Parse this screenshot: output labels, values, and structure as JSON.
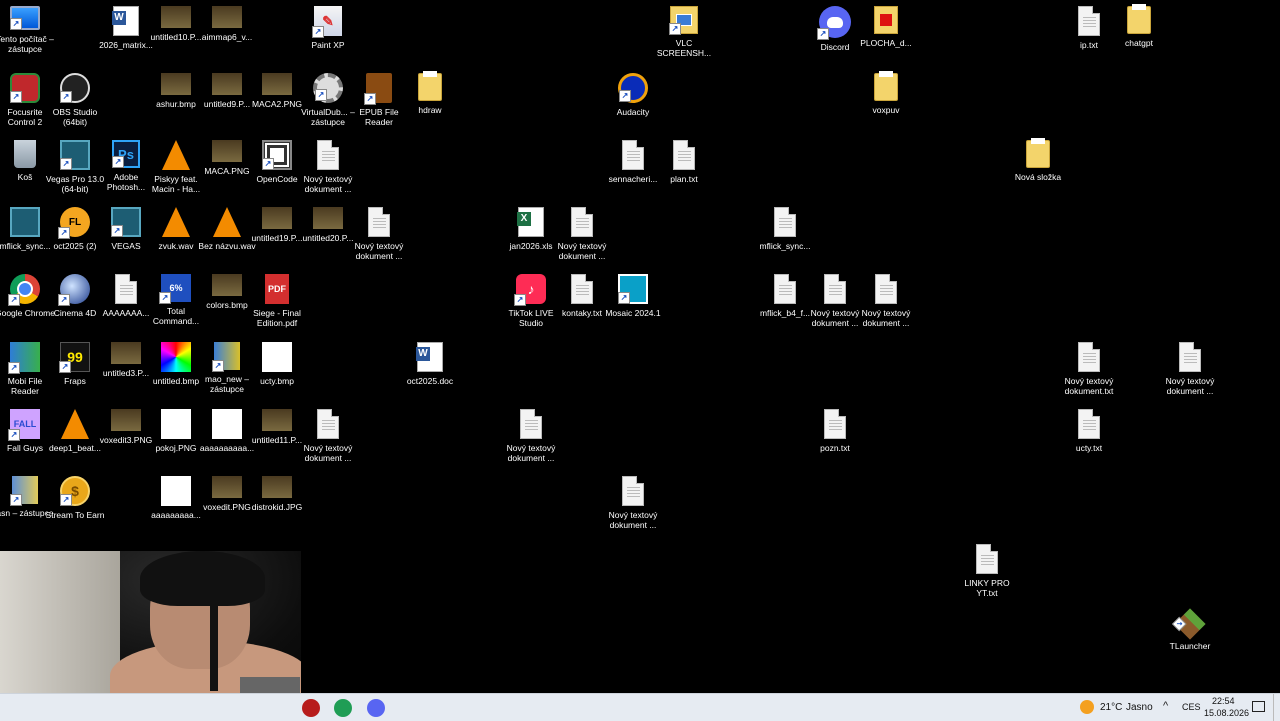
{
  "desktop": {
    "icons": [
      {
        "label": "Tento počítač – zástupce",
        "glyph": "monitor",
        "icon": "computer-icon",
        "shortcut": true
      },
      {
        "label": "Focusrite Control 2",
        "glyph": "focus",
        "icon": "focusrite-icon",
        "shortcut": true
      },
      {
        "label": "Koš",
        "glyph": "bin",
        "icon": "recycle-bin-icon",
        "shortcut": false
      },
      {
        "label": "mflick_sync...",
        "glyph": "vegas",
        "icon": "video-file-icon",
        "shortcut": false
      },
      {
        "label": "Google Chrome",
        "glyph": "chrome",
        "icon": "chrome-icon",
        "shortcut": true
      },
      {
        "label": "Mobi File Reader",
        "glyph": "mobi",
        "icon": "mobi-reader-icon",
        "shortcut": true
      },
      {
        "label": "Fall Guys",
        "glyph": "fall",
        "icon": "fall-guys-icon",
        "glyph_text": "FALL",
        "shortcut": true
      },
      {
        "label": "asn – zástupce",
        "glyph": "inst",
        "icon": "archive-icon",
        "shortcut": true
      },
      {
        "label": "OBS Studio (64bit)",
        "glyph": "obs",
        "icon": "obs-icon",
        "shortcut": true
      },
      {
        "label": "Vegas Pro 13.0 (64-bit)",
        "glyph": "vegas",
        "icon": "vegas-icon",
        "shortcut": true
      },
      {
        "label": "oct2025 (2)",
        "glyph": "fl",
        "icon": "fl-studio-icon",
        "glyph_text": "FL",
        "shortcut": true
      },
      {
        "label": "Cinema 4D",
        "glyph": "c4d",
        "icon": "cinema4d-icon",
        "shortcut": true
      },
      {
        "label": "Fraps",
        "glyph": "fraps",
        "icon": "fraps-icon",
        "glyph_text": "99",
        "shortcut": true
      },
      {
        "label": "deep1_beat...",
        "glyph": "vlc",
        "icon": "vlc-file-icon",
        "shortcut": false
      },
      {
        "label": "Stream To Earn",
        "glyph": "coin",
        "icon": "coin-icon",
        "glyph_text": "$",
        "shortcut": true
      },
      {
        "label": "2026_matrix...",
        "glyph": "word",
        "icon": "word-doc-icon",
        "shortcut": false
      },
      {
        "label": "Adobe Photosh...",
        "glyph": "ps",
        "icon": "photoshop-icon",
        "glyph_text": "Ps",
        "shortcut": true
      },
      {
        "label": "VEGAS",
        "glyph": "vegas",
        "icon": "vegas-icon",
        "shortcut": true
      },
      {
        "label": "AAAAAAA...",
        "glyph": "doc",
        "icon": "text-file-icon",
        "shortcut": false
      },
      {
        "label": "untitled3.P...",
        "glyph": "img",
        "icon": "image-file-icon",
        "shortcut": false
      },
      {
        "label": "voxedit3.PNG",
        "glyph": "img",
        "icon": "image-file-icon",
        "shortcut": false
      },
      {
        "label": "untitled10.P...",
        "glyph": "img",
        "icon": "image-file-icon",
        "shortcut": false
      },
      {
        "label": "ashur.bmp",
        "glyph": "img",
        "icon": "image-file-icon",
        "shortcut": false
      },
      {
        "label": "Piskyy feat. Macin - Ha...",
        "glyph": "vlc",
        "icon": "vlc-file-icon",
        "shortcut": false
      },
      {
        "label": "zvuk.wav",
        "glyph": "vlc",
        "icon": "vlc-file-icon",
        "shortcut": false
      },
      {
        "label": "Total Command...",
        "glyph": "total",
        "icon": "total-commander-icon",
        "glyph_text": "6%",
        "shortcut": true
      },
      {
        "label": "untitled.bmp",
        "glyph": "imgcolor",
        "icon": "image-file-icon",
        "shortcut": false
      },
      {
        "label": "pokoj.PNG",
        "glyph": "imgw",
        "icon": "image-file-icon",
        "shortcut": false
      },
      {
        "label": "aaaaaaaaa...",
        "glyph": "imgw",
        "icon": "image-file-icon",
        "shortcut": false
      },
      {
        "label": "aimmap6_v...",
        "glyph": "img",
        "icon": "image-file-icon",
        "shortcut": false
      },
      {
        "label": "untitled9.P...",
        "glyph": "img",
        "icon": "image-file-icon",
        "shortcut": false
      },
      {
        "label": "MACA.PNG",
        "glyph": "img",
        "icon": "image-file-icon",
        "shortcut": false
      },
      {
        "label": "Bez názvu.wav",
        "glyph": "vlc",
        "icon": "vlc-file-icon",
        "shortcut": false
      },
      {
        "label": "colors.bmp",
        "glyph": "img",
        "icon": "image-file-icon",
        "shortcut": false
      },
      {
        "label": "mao_new – zástupce",
        "glyph": "winrar",
        "icon": "archive-icon",
        "shortcut": true
      },
      {
        "label": "aaaaaaaaaa...",
        "glyph": "imgw",
        "icon": "image-file-icon",
        "shortcut": false
      },
      {
        "label": "voxedit.PNG",
        "glyph": "img",
        "icon": "image-file-icon",
        "shortcut": false
      },
      {
        "label": "MACA2.PNG",
        "glyph": "img",
        "icon": "image-file-icon",
        "shortcut": false
      },
      {
        "label": "OpenCode",
        "glyph": "opencode",
        "icon": "opencode-icon",
        "shortcut": true
      },
      {
        "label": "untitled19.P...",
        "glyph": "img",
        "icon": "image-file-icon",
        "shortcut": false
      },
      {
        "label": "Siege - Final Edition.pdf",
        "glyph": "pdf",
        "icon": "pdf-icon",
        "glyph_text": "PDF",
        "shortcut": false
      },
      {
        "label": "ucty.bmp",
        "glyph": "imgw",
        "icon": "image-file-icon",
        "shortcut": false
      },
      {
        "label": "untitled11.P...",
        "glyph": "img",
        "icon": "image-file-icon",
        "shortcut": false
      },
      {
        "label": "distrokid.JPG",
        "glyph": "img",
        "icon": "image-file-icon",
        "shortcut": false
      },
      {
        "label": "Paint XP",
        "glyph": "paint",
        "icon": "paint-icon",
        "glyph_text": "✎",
        "shortcut": true
      },
      {
        "label": "VirtualDub... – zástupce",
        "glyph": "gear",
        "icon": "virtualdub-icon",
        "shortcut": true
      },
      {
        "label": "Nový textový dokument ...",
        "glyph": "doc",
        "icon": "text-file-icon",
        "shortcut": false
      },
      {
        "label": "untitled20.P...",
        "glyph": "img",
        "icon": "image-file-icon",
        "shortcut": false
      },
      {
        "label": "Nový textový dokument ...",
        "glyph": "doc",
        "icon": "text-file-icon",
        "shortcut": false
      },
      {
        "label": "EPUB File Reader",
        "glyph": "epub",
        "icon": "epub-reader-icon",
        "shortcut": true
      },
      {
        "label": "Nový textový dokument ...",
        "glyph": "doc",
        "icon": "text-file-icon",
        "shortcut": false
      },
      {
        "label": "hdraw",
        "glyph": "folder",
        "icon": "folder-icon",
        "shortcut": false
      },
      {
        "label": "oct2025.doc",
        "glyph": "word",
        "icon": "word-doc-icon",
        "shortcut": false
      },
      {
        "label": "jan2026.xls",
        "glyph": "excel",
        "icon": "excel-file-icon",
        "shortcut": false
      },
      {
        "label": "TikTok LIVE Studio",
        "glyph": "tiktok",
        "icon": "tiktok-icon",
        "glyph_text": "♪",
        "shortcut": true
      },
      {
        "label": "Nový textový dokument ...",
        "glyph": "doc",
        "icon": "text-file-icon",
        "shortcut": false
      },
      {
        "label": "Nový textový dokument ...",
        "glyph": "doc",
        "icon": "text-file-icon",
        "shortcut": false
      },
      {
        "label": "kontaky.txt",
        "glyph": "doc",
        "icon": "text-file-icon",
        "shortcut": false
      },
      {
        "label": "Audacity",
        "glyph": "audacity",
        "icon": "audacity-icon",
        "shortcut": true
      },
      {
        "label": "sennacheri...",
        "glyph": "doc",
        "icon": "text-file-icon",
        "shortcut": false
      },
      {
        "label": "Mosaic 2024.1",
        "glyph": "mosaic",
        "icon": "mosaic-icon",
        "shortcut": true
      },
      {
        "label": "Nový textový dokument ...",
        "glyph": "doc",
        "icon": "text-file-icon",
        "shortcut": false
      },
      {
        "label": "VLC SCREENSH...",
        "glyph": "vlcfolder",
        "icon": "folder-icon",
        "shortcut": true
      },
      {
        "label": "plan.txt",
        "glyph": "doc",
        "icon": "text-file-icon",
        "shortcut": false
      },
      {
        "label": "mflick_sync...",
        "glyph": "doc",
        "icon": "text-file-icon",
        "shortcut": false
      },
      {
        "label": "mflick_b4_f...",
        "glyph": "doc",
        "icon": "text-file-icon",
        "shortcut": false
      },
      {
        "label": "Discord",
        "glyph": "discord",
        "icon": "discord-icon",
        "shortcut": true
      },
      {
        "label": "Nový textový dokument ...",
        "glyph": "doc",
        "icon": "text-file-icon",
        "shortcut": false
      },
      {
        "label": "pozn.txt",
        "glyph": "doc",
        "icon": "text-file-icon",
        "shortcut": false
      },
      {
        "label": "PLOCHA_d...",
        "glyph": "pfolder",
        "icon": "folder-icon",
        "shortcut": false
      },
      {
        "label": "voxpuv",
        "glyph": "folder",
        "icon": "folder-icon",
        "shortcut": false
      },
      {
        "label": "Nový textový dokument ...",
        "glyph": "doc",
        "icon": "text-file-icon",
        "shortcut": false
      },
      {
        "label": "LINKY PRO YT.txt",
        "glyph": "doc",
        "icon": "text-file-icon",
        "shortcut": false
      },
      {
        "label": "Nová složka",
        "glyph": "folder",
        "icon": "folder-icon",
        "shortcut": false
      },
      {
        "label": "ucty.txt",
        "glyph": "doc",
        "icon": "text-file-icon",
        "shortcut": false
      },
      {
        "label": "ip.txt",
        "glyph": "doc",
        "icon": "text-file-icon",
        "shortcut": false
      },
      {
        "label": "Nový textový dokument.txt",
        "glyph": "doc",
        "icon": "text-file-icon",
        "shortcut": false
      },
      {
        "label": "chatgpt",
        "glyph": "folder",
        "icon": "folder-icon",
        "shortcut": false
      },
      {
        "label": "Nový textový dokument ...",
        "glyph": "doc",
        "icon": "text-file-icon",
        "shortcut": false
      },
      {
        "label": "TLauncher",
        "glyph": "mc",
        "icon": "minecraft-icon",
        "shortcut": true
      }
    ]
  },
  "taskbar": {
    "apps": [
      {
        "name": "taskbar-app-recorder",
        "icon": "record-icon",
        "color": "#b71c1c"
      },
      {
        "name": "taskbar-app-chat",
        "icon": "chat-icon",
        "color": "#1f9d55"
      },
      {
        "name": "taskbar-app-discord",
        "icon": "discord-icon",
        "color": "#5865f2"
      }
    ],
    "weather": {
      "temp": "21°C",
      "condition": "Jasno"
    },
    "language": "CES",
    "time": "22:54",
    "date": "15.08.2026"
  }
}
